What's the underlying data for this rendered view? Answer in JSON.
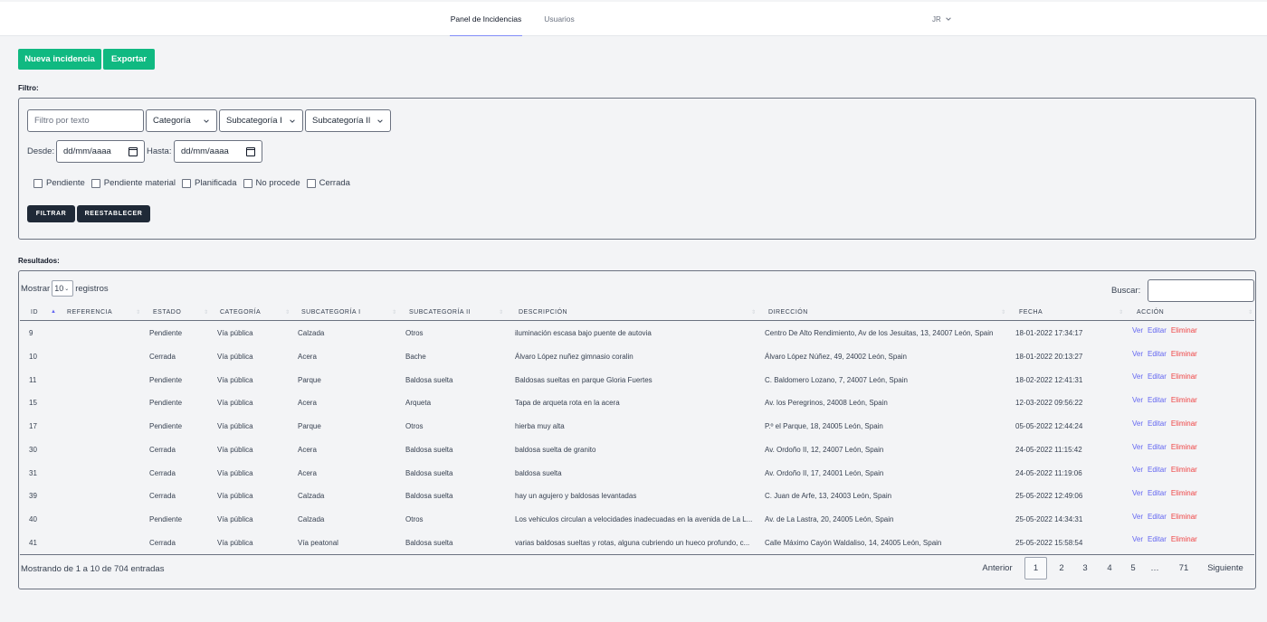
{
  "nav": {
    "tabs": [
      {
        "label": "Panel de Incidencias",
        "active": true
      },
      {
        "label": "Usuarios",
        "active": false
      }
    ],
    "user_initials": "JR"
  },
  "actions": {
    "new_label": "Nueva incidencia",
    "export_label": "Exportar"
  },
  "filter": {
    "section_label": "Filtro:",
    "text_placeholder": "Filtro por texto",
    "selects": [
      "Categoría",
      "Subcategoría I",
      "Subcategoría II"
    ],
    "desde_label": "Desde:",
    "hasta_label": "Hasta:",
    "date_placeholder": "dd/mm/aaaa",
    "statuses": [
      "Pendiente",
      "Pendiente material",
      "Planificada",
      "No procede",
      "Cerrada"
    ],
    "filter_btn": "FILTRAR",
    "reset_btn": "REESTABLECER"
  },
  "results": {
    "section_label": "Resultados:",
    "show_prefix": "Mostrar",
    "page_length": "10",
    "show_suffix": "registros",
    "search_label": "Buscar:",
    "columns": [
      "ID",
      "REFERENCIA",
      "ESTADO",
      "CATEGORÍA",
      "SUBCATEGORÍA I",
      "SUBCATEGORÍA II",
      "DESCRIPCIÓN",
      "DIRECCIÓN",
      "FECHA",
      "ACCIÓN"
    ],
    "rows": [
      {
        "id": "9",
        "ref": "",
        "estado": "Pendiente",
        "cat": "Vía pública",
        "sub1": "Calzada",
        "sub2": "Otros",
        "desc": "iluminación escasa bajo puente de autovia",
        "dir": "Centro De Alto Rendimiento, Av de los Jesuitas, 13, 24007 León, Spain",
        "fecha": "18-01-2022 17:34:17"
      },
      {
        "id": "10",
        "ref": "",
        "estado": "Cerrada",
        "cat": "Vía pública",
        "sub1": "Acera",
        "sub2": "Bache",
        "desc": "Álvaro López nuñez gimnasio coralin",
        "dir": "Álvaro López Núñez, 49, 24002 León, Spain",
        "fecha": "18-01-2022 20:13:27"
      },
      {
        "id": "11",
        "ref": "",
        "estado": "Pendiente",
        "cat": "Vía pública",
        "sub1": "Parque",
        "sub2": "Baldosa suelta",
        "desc": "Baldosas sueltas en parque Gloria Fuertes",
        "dir": "C. Baldomero Lozano, 7, 24007 León, Spain",
        "fecha": "18-02-2022 12:41:31"
      },
      {
        "id": "15",
        "ref": "",
        "estado": "Pendiente",
        "cat": "Vía pública",
        "sub1": "Acera",
        "sub2": "Arqueta",
        "desc": "Tapa de arqueta rota en la acera",
        "dir": "Av. los Peregrinos, 24008 León, Spain",
        "fecha": "12-03-2022 09:56:22"
      },
      {
        "id": "17",
        "ref": "",
        "estado": "Pendiente",
        "cat": "Vía pública",
        "sub1": "Parque",
        "sub2": "Otros",
        "desc": "hierba muy alta",
        "dir": "P.º el Parque, 18, 24005 León, Spain",
        "fecha": "05-05-2022 12:44:24"
      },
      {
        "id": "30",
        "ref": "",
        "estado": "Cerrada",
        "cat": "Vía pública",
        "sub1": "Acera",
        "sub2": "Baldosa suelta",
        "desc": "baldosa suelta de granito",
        "dir": "Av. Ordoño II, 12, 24007 León, Spain",
        "fecha": "24-05-2022 11:15:42"
      },
      {
        "id": "31",
        "ref": "",
        "estado": "Cerrada",
        "cat": "Vía pública",
        "sub1": "Acera",
        "sub2": "Baldosa suelta",
        "desc": "baldosa suelta",
        "dir": "Av. Ordoño II, 17, 24001 León, Spain",
        "fecha": "24-05-2022 11:19:06"
      },
      {
        "id": "39",
        "ref": "",
        "estado": "Cerrada",
        "cat": "Vía pública",
        "sub1": "Calzada",
        "sub2": "Baldosa suelta",
        "desc": "hay un agujero y baldosas levantadas",
        "dir": "C. Juan de Arfe, 13, 24003 León, Spain",
        "fecha": "25-05-2022 12:49:06"
      },
      {
        "id": "40",
        "ref": "",
        "estado": "Pendiente",
        "cat": "Vía pública",
        "sub1": "Calzada",
        "sub2": "Otros",
        "desc": "Los vehiculos circulan a velocidades inadecuadas en la avenida de La L...",
        "dir": "Av. de La Lastra, 20, 24005 León, Spain",
        "fecha": "25-05-2022 14:34:31"
      },
      {
        "id": "41",
        "ref": "",
        "estado": "Cerrada",
        "cat": "Vía pública",
        "sub1": "Vía peatonal",
        "sub2": "Baldosa suelta",
        "desc": "varias baldosas sueltas y rotas, alguna cubriendo un hueco profundo, c...",
        "dir": "Calle Máximo Cayón Waldaliso, 14, 24005 León, Spain",
        "fecha": "25-05-2022 15:58:54"
      }
    ],
    "row_actions": {
      "view": "Ver",
      "edit": "Editar",
      "delete": "Eliminar"
    },
    "info": "Mostrando de 1 a 10 de 704 entradas",
    "pagination": {
      "prev": "Anterior",
      "pages": [
        "1",
        "2",
        "3",
        "4",
        "5",
        "…",
        "71"
      ],
      "current": "1",
      "next": "Siguiente"
    }
  }
}
